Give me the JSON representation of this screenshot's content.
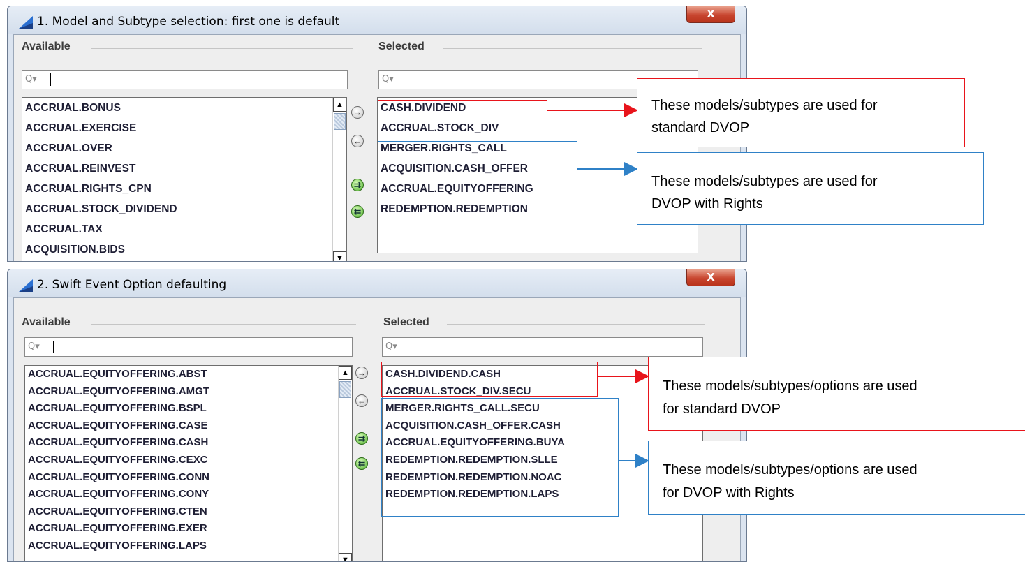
{
  "window1": {
    "title": "1. Model and Subtype selection: first one is default",
    "close_label": "X",
    "available_label": "Available",
    "selected_label": "Selected",
    "search_icon": "Q▾",
    "available_items": [
      "ACCRUAL.BONUS",
      "ACCRUAL.EXERCISE",
      "ACCRUAL.OVER",
      "ACCRUAL.REINVEST",
      "ACCRUAL.RIGHTS_CPN",
      "ACCRUAL.STOCK_DIVIDEND",
      "ACCRUAL.TAX",
      "ACQUISITION.BIDS"
    ],
    "selected_items": [
      "CASH.DIVIDEND",
      "ACCRUAL.STOCK_DIV",
      "MERGER.RIGHTS_CALL",
      "ACQUISITION.CASH_OFFER",
      "ACCRUAL.EQUITYOFFERING",
      "REDEMPTION.REDEMPTION"
    ]
  },
  "window2": {
    "title": "2. Swift Event Option defaulting",
    "close_label": "X",
    "available_label": "Available",
    "selected_label": "Selected",
    "search_icon": "Q▾",
    "available_items": [
      "ACCRUAL.EQUITYOFFERING.ABST",
      "ACCRUAL.EQUITYOFFERING.AMGT",
      "ACCRUAL.EQUITYOFFERING.BSPL",
      "ACCRUAL.EQUITYOFFERING.CASE",
      "ACCRUAL.EQUITYOFFERING.CASH",
      "ACCRUAL.EQUITYOFFERING.CEXC",
      "ACCRUAL.EQUITYOFFERING.CONN",
      "ACCRUAL.EQUITYOFFERING.CONY",
      "ACCRUAL.EQUITYOFFERING.CTEN",
      "ACCRUAL.EQUITYOFFERING.EXER",
      "ACCRUAL.EQUITYOFFERING.LAPS"
    ],
    "selected_items": [
      "CASH.DIVIDEND.CASH",
      "ACCRUAL.STOCK_DIV.SECU",
      "MERGER.RIGHTS_CALL.SECU",
      "ACQUISITION.CASH_OFFER.CASH",
      "ACCRUAL.EQUITYOFFERING.BUYA",
      "REDEMPTION.REDEMPTION.SLLE",
      "REDEMPTION.REDEMPTION.NOAC",
      "REDEMPTION.REDEMPTION.LAPS"
    ]
  },
  "buttons": {
    "add": "→",
    "remove": "←",
    "add_all": "⇉",
    "remove_all": "⇇"
  },
  "annotations": {
    "note1": [
      "These models/subtypes are used for",
      "standard DVOP"
    ],
    "note2": [
      "These models/subtypes are used for",
      "DVOP with Rights"
    ],
    "note3": [
      "These models/subtypes/options are used",
      "for standard DVOP"
    ],
    "note4": [
      "These models/subtypes/options are used",
      "for DVOP with Rights"
    ]
  },
  "colors": {
    "standard_annotation": "#e8141b",
    "rights_annotation": "#2f81c7"
  }
}
